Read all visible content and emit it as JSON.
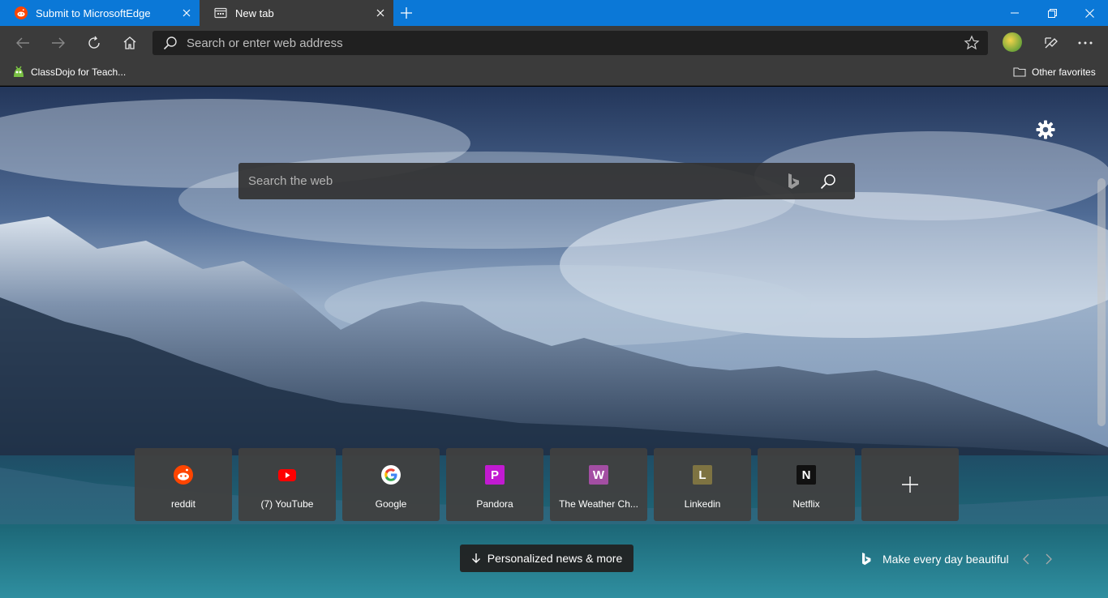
{
  "tabs": [
    {
      "label": "Submit to MicrosoftEdge",
      "favicon": "reddit-icon",
      "active": false
    },
    {
      "label": "New tab",
      "favicon": "newtab-icon",
      "active": true
    }
  ],
  "toolbar": {
    "address_placeholder": "Search or enter web address"
  },
  "favorites": {
    "items": [
      {
        "label": "ClassDojo for Teach..."
      }
    ],
    "other_label": "Other favorites"
  },
  "newtab": {
    "search_placeholder": "Search the web",
    "tiles": [
      {
        "label": "reddit",
        "icon": "reddit-icon",
        "color": "#ff4500"
      },
      {
        "label": "(7) YouTube",
        "icon": "youtube-icon",
        "color": "#ff0000"
      },
      {
        "label": "Google",
        "icon": "google-icon",
        "color": "#4285f4"
      },
      {
        "label": "Pandora",
        "icon": "P",
        "color": "#c21ad1"
      },
      {
        "label": "The Weather Ch...",
        "icon": "W",
        "color": "#a34ea3"
      },
      {
        "label": "Linkedin",
        "icon": "L",
        "color": "#7e7342"
      },
      {
        "label": "Netflix",
        "icon": "N",
        "color": "#111111"
      }
    ],
    "news_label": "Personalized news & more",
    "image_caption": "Make every day beautiful"
  },
  "colors": {
    "accent": "#0b78d7",
    "chrome": "#3b3b3b",
    "address_bg": "#202020"
  }
}
